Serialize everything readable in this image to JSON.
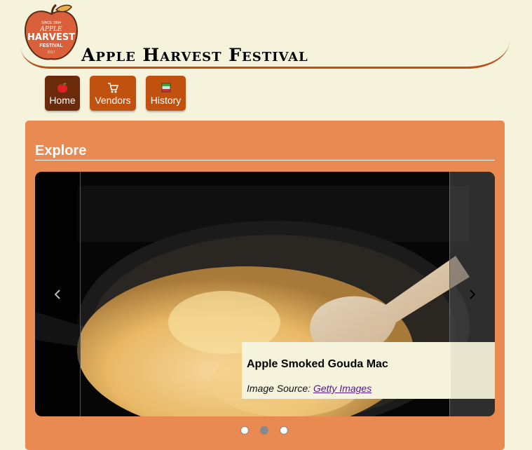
{
  "logo": {
    "line1": "SINCE 1994",
    "line2": "APPLE",
    "line3": "HARVEST",
    "line4": "FESTIVAL",
    "line5": "2017"
  },
  "site_title": "Apple Harvest Festival",
  "nav": [
    {
      "label": "Home",
      "icon": "apple-icon",
      "active": true
    },
    {
      "label": "Vendors",
      "icon": "cart-icon",
      "active": false
    },
    {
      "label": "History",
      "icon": "books-icon",
      "active": false
    }
  ],
  "section": {
    "title": "Explore"
  },
  "carousel": {
    "slide": {
      "title": "Apple Smoked Gouda Mac",
      "source_prefix": "Image Source:",
      "source_link": "Getty Images"
    },
    "prev_icon": "chevron-left-icon",
    "next_icon": "chevron-right-icon",
    "slide_count": 3,
    "active_index": 1
  },
  "colors": {
    "background": "#f5f3dc",
    "panel": "#e98a52",
    "nav_button": "#c0510f",
    "nav_active": "#6b2a0a",
    "header_line": "#b8521c"
  }
}
